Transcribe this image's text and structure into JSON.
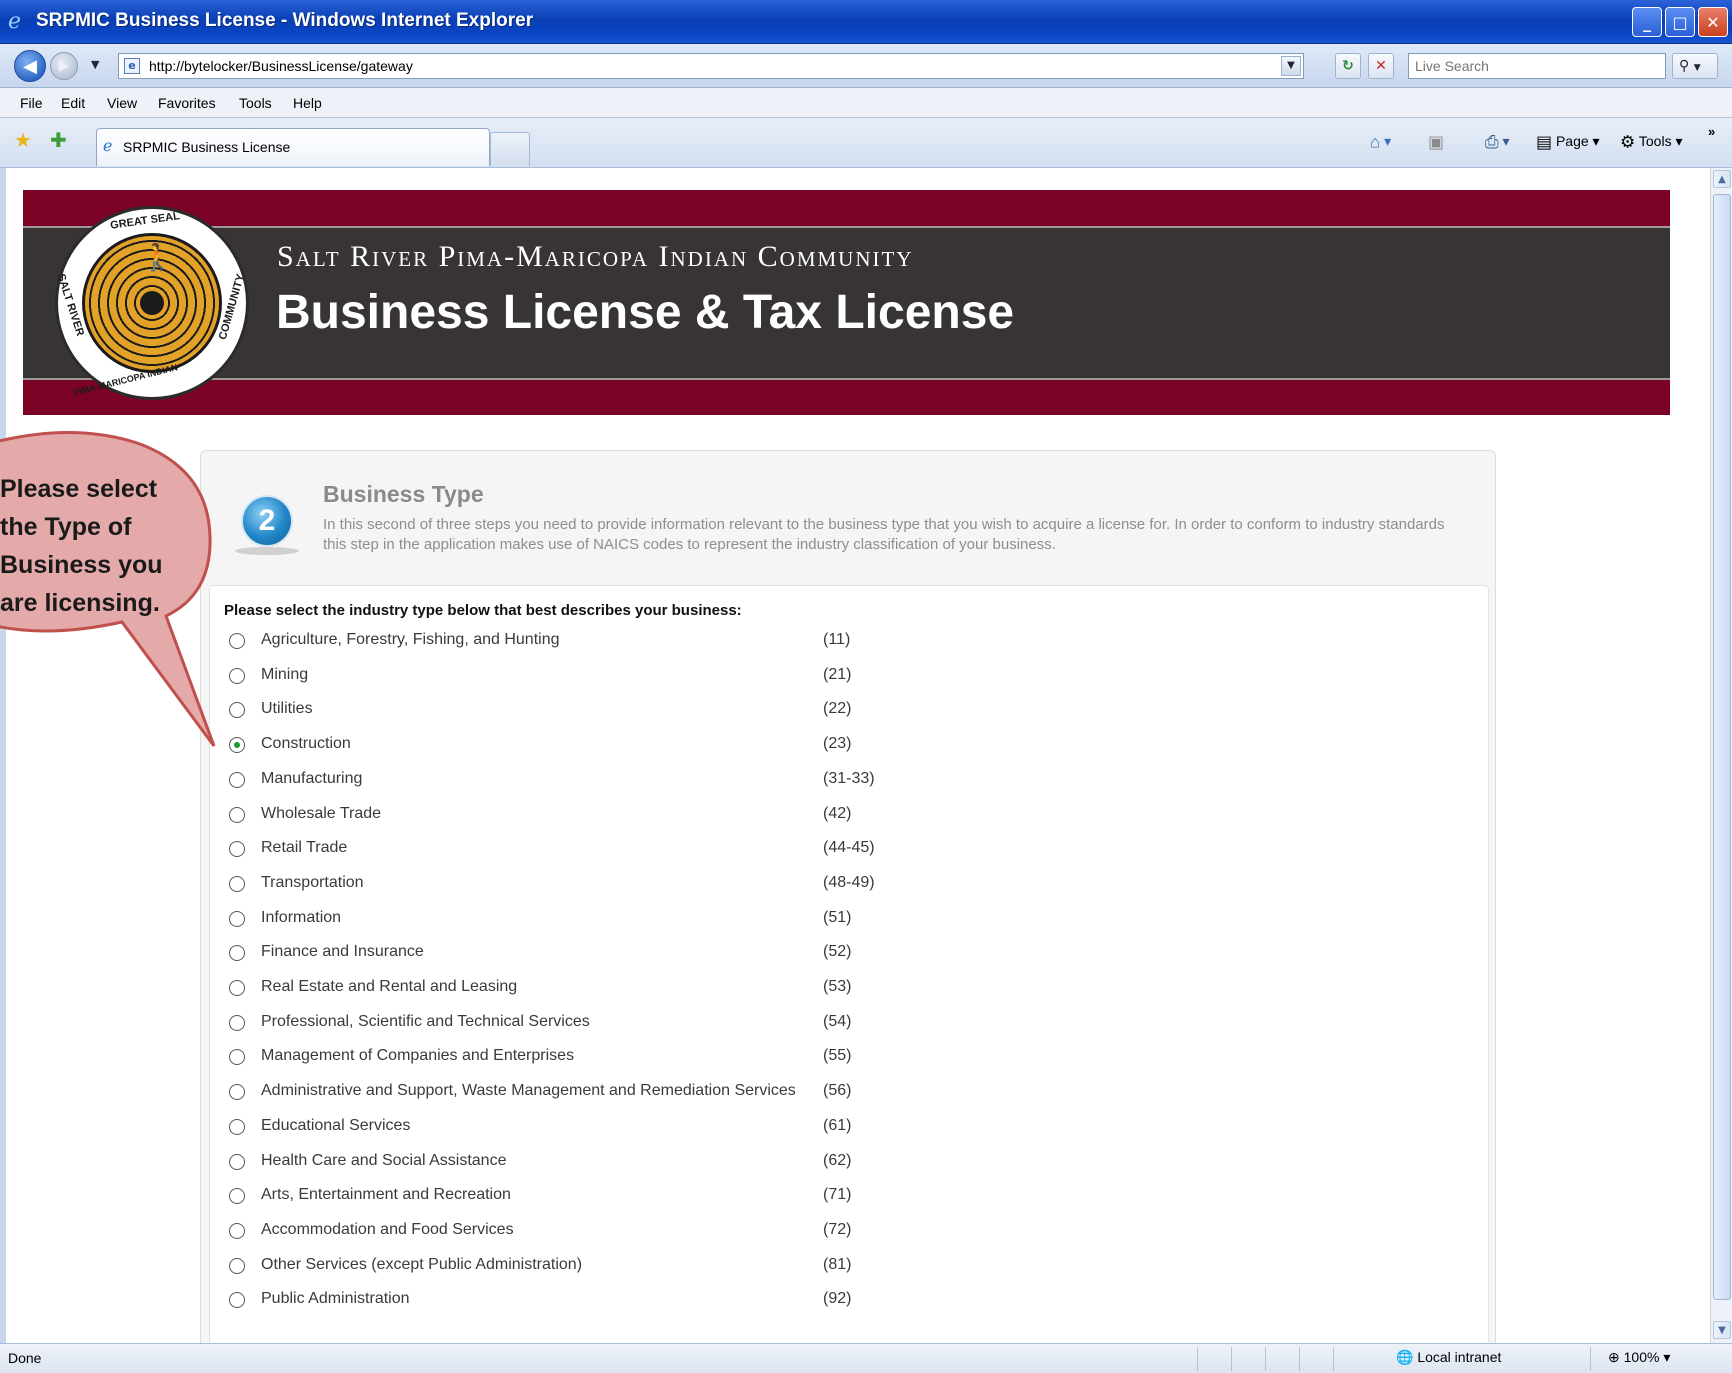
{
  "window": {
    "title": "SRPMIC Business License - Windows Internet Explorer",
    "minimize_glyph": "_",
    "maximize_glyph": "□",
    "close_glyph": "✕"
  },
  "address_bar": {
    "url": "http://bytelocker/BusinessLicense/gateway",
    "search_placeholder": "Live Search"
  },
  "menu": [
    "File",
    "Edit",
    "View",
    "Favorites",
    "Tools",
    "Help"
  ],
  "tab": {
    "label": "SRPMIC Business License"
  },
  "command_bar": {
    "page_label": "Page",
    "tools_label": "Tools"
  },
  "header": {
    "community": "Salt River Pima-Maricopa Indian Community",
    "app_title": "Business License & Tax License",
    "seal_text_top": "GREAT SEAL",
    "seal_text_left": "SALT RIVER",
    "seal_text_bottom": "PIMA-MARICOPA INDIAN",
    "seal_text_right": "COMMUNITY"
  },
  "step": {
    "number": "2",
    "title": "Business Type",
    "description": "In this second of three steps you need to provide information relevant to the business type that you wish to acquire a license for. In order to conform to industry standards this step in the application makes use of NAICS codes to represent the industry classification of your business."
  },
  "industry": {
    "prompt": "Please select the industry type below that best describes your business:",
    "selected": "Construction",
    "options": [
      {
        "label": "Agriculture, Forestry, Fishing, and Hunting",
        "code": "(11)"
      },
      {
        "label": "Mining",
        "code": "(21)"
      },
      {
        "label": "Utilities",
        "code": "(22)"
      },
      {
        "label": "Construction",
        "code": "(23)"
      },
      {
        "label": "Manufacturing",
        "code": "(31-33)"
      },
      {
        "label": "Wholesale Trade",
        "code": "(42)"
      },
      {
        "label": "Retail Trade",
        "code": "(44-45)"
      },
      {
        "label": "Transportation",
        "code": "(48-49)"
      },
      {
        "label": "Information",
        "code": "(51)"
      },
      {
        "label": "Finance and Insurance",
        "code": "(52)"
      },
      {
        "label": "Real Estate and Rental and Leasing",
        "code": "(53)"
      },
      {
        "label": "Professional, Scientific and Technical Services",
        "code": "(54)"
      },
      {
        "label": "Management of Companies and Enterprises",
        "code": "(55)"
      },
      {
        "label": "Administrative and Support, Waste Management and Remediation Services",
        "code": "(56)"
      },
      {
        "label": "Educational Services",
        "code": "(61)"
      },
      {
        "label": "Health Care and Social Assistance",
        "code": "(62)"
      },
      {
        "label": "Arts, Entertainment and Recreation",
        "code": "(71)"
      },
      {
        "label": "Accommodation and Food Services",
        "code": "(72)"
      },
      {
        "label": "Other Services (except Public Administration)",
        "code": "(81)"
      },
      {
        "label": "Public Administration",
        "code": "(92)"
      }
    ]
  },
  "callout": {
    "text": "Please select\nthe Type of\nBusiness you\nare licensing."
  },
  "status_bar": {
    "status": "Done",
    "zone": "Local intranet",
    "zoom": "100%"
  },
  "colors": {
    "banner_red": "#7b0225",
    "banner_dark": "#383434",
    "callout_fill": "#e4aaaa",
    "callout_border": "#c0504d",
    "selected_dot": "#1c9b3a"
  }
}
